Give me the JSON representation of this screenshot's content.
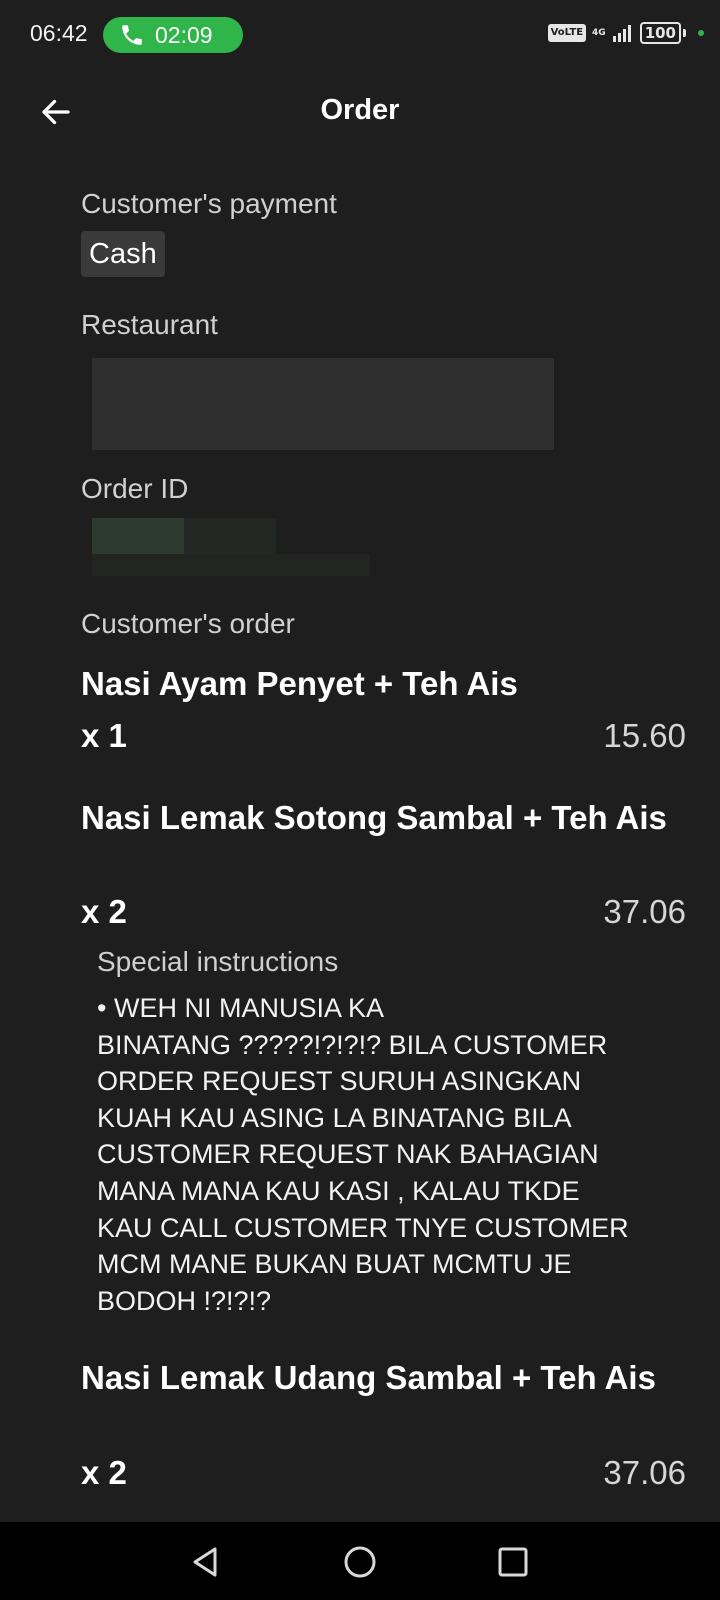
{
  "status_bar": {
    "time": "06:42",
    "call_timer": "02:09",
    "volte_label": "VoLTE",
    "network_label": "4G",
    "battery_level": "100"
  },
  "header": {
    "title": "Order"
  },
  "payment": {
    "label": "Customer's payment",
    "method": "Cash"
  },
  "restaurant": {
    "label": "Restaurant"
  },
  "order_id": {
    "label": "Order ID"
  },
  "order": {
    "label": "Customer's order",
    "items": [
      {
        "name": "Nasi Ayam Penyet + Teh Ais",
        "quantity": "x 1",
        "price": "15.60"
      },
      {
        "name": "Nasi Lemak Sotong Sambal + Teh Ais",
        "quantity": "x 2",
        "price": "37.06",
        "special_instructions_label": "Special instructions",
        "special_instructions": "• WEH NI MANUSIA KA\nBINATANG ?????!?!?!? BILA CUSTOMER\nORDER REQUEST SURUH ASINGKAN\nKUAH KAU ASING LA BINATANG BILA\nCUSTOMER REQUEST NAK BAHAGIAN\nMANA MANA KAU KASI , KALAU TKDE\nKAU CALL CUSTOMER TNYE CUSTOMER\nMCM MANE BUKAN BUAT MCMTU JE\nBODOH !?!?!?"
      },
      {
        "name": "Nasi Lemak Udang Sambal + Teh Ais",
        "quantity": "x 2",
        "price": "37.06"
      }
    ]
  },
  "icons": {
    "back": "arrow-left-icon",
    "phone": "phone-icon",
    "nav_back": "triangle-back-icon",
    "nav_home": "circle-home-icon",
    "nav_recents": "square-recents-icon"
  },
  "colors": {
    "background": "#1e1e1e",
    "call_pill": "#2fb54a",
    "chip": "#3a3a3a",
    "nav_bar": "#000000"
  }
}
